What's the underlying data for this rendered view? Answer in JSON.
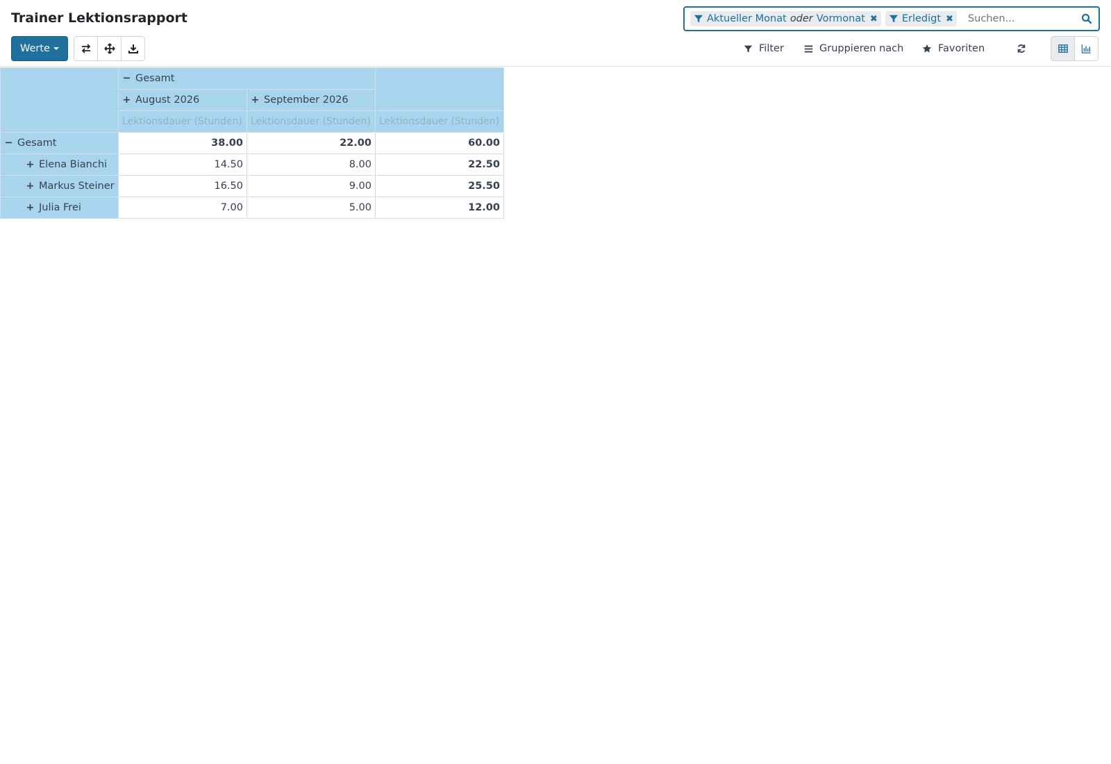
{
  "title": "Trainer Lektionsrapport",
  "search": {
    "facets": [
      {
        "icon": "filter-icon",
        "parts": [
          "Aktueller Monat",
          "oder",
          "Vormonat"
        ]
      },
      {
        "icon": "filter-icon",
        "parts": [
          "Erledigt"
        ]
      }
    ],
    "placeholder": "Suchen..."
  },
  "toolbar": {
    "measures_label": "Werte",
    "filter_label": "Filter",
    "groupby_label": "Gruppieren nach",
    "favorites_label": "Favoriten"
  },
  "pivot": {
    "col_total": "Gesamt",
    "col_groups": [
      "August 2026",
      "September 2026"
    ],
    "measure": "Lektionsdauer (Stunden)",
    "row_total": {
      "label": "Gesamt",
      "values": [
        "38.00",
        "22.00",
        "60.00"
      ]
    },
    "rows": [
      {
        "label": "Elena Bianchi",
        "values": [
          "14.50",
          "8.00",
          "22.50"
        ]
      },
      {
        "label": "Markus Steiner",
        "values": [
          "16.50",
          "9.00",
          "25.50"
        ]
      },
      {
        "label": "Julia Frei",
        "values": [
          "7.00",
          "5.00",
          "12.00"
        ]
      }
    ]
  },
  "colors": {
    "primary": "#1f6f9f",
    "header_bg": "#a8d4ee"
  }
}
